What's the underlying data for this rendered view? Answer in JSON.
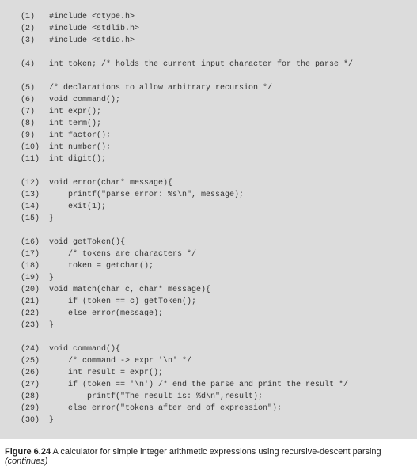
{
  "code": {
    "lines": [
      {
        "no": "(1)",
        "text": "#include <ctype.h>"
      },
      {
        "no": "(2)",
        "text": "#include <stdlib.h>"
      },
      {
        "no": "(3)",
        "text": "#include <stdio.h>"
      },
      {
        "no": "",
        "text": ""
      },
      {
        "no": "(4)",
        "text": "int token; /* holds the current input character for the parse */"
      },
      {
        "no": "",
        "text": ""
      },
      {
        "no": "(5)",
        "text": "/* declarations to allow arbitrary recursion */"
      },
      {
        "no": "(6)",
        "text": "void command();"
      },
      {
        "no": "(7)",
        "text": "int expr();"
      },
      {
        "no": "(8)",
        "text": "int term();"
      },
      {
        "no": "(9)",
        "text": "int factor();"
      },
      {
        "no": "(10)",
        "text": "int number();"
      },
      {
        "no": "(11)",
        "text": "int digit();"
      },
      {
        "no": "",
        "text": ""
      },
      {
        "no": "(12)",
        "text": "void error(char* message){"
      },
      {
        "no": "(13)",
        "text": "    printf(\"parse error: %s\\n\", message);"
      },
      {
        "no": "(14)",
        "text": "    exit(1);"
      },
      {
        "no": "(15)",
        "text": "}"
      },
      {
        "no": "",
        "text": ""
      },
      {
        "no": "(16)",
        "text": "void getToken(){"
      },
      {
        "no": "(17)",
        "text": "    /* tokens are characters */"
      },
      {
        "no": "(18)",
        "text": "    token = getchar();"
      },
      {
        "no": "(19)",
        "text": "}"
      },
      {
        "no": "(20)",
        "text": "void match(char c, char* message){"
      },
      {
        "no": "(21)",
        "text": "    if (token == c) getToken();"
      },
      {
        "no": "(22)",
        "text": "    else error(message);"
      },
      {
        "no": "(23)",
        "text": "}"
      },
      {
        "no": "",
        "text": ""
      },
      {
        "no": "(24)",
        "text": "void command(){"
      },
      {
        "no": "(25)",
        "text": "    /* command -> expr '\\n' */"
      },
      {
        "no": "(26)",
        "text": "    int result = expr();"
      },
      {
        "no": "(27)",
        "text": "    if (token == '\\n') /* end the parse and print the result */"
      },
      {
        "no": "(28)",
        "text": "        printf(\"The result is: %d\\n\",result);"
      },
      {
        "no": "(29)",
        "text": "    else error(\"tokens after end of expression\");"
      },
      {
        "no": "(30)",
        "text": "}"
      }
    ]
  },
  "caption": {
    "label": "Figure 6.24",
    "text": "A calculator for simple integer arithmetic expressions using recursive-descent parsing",
    "continues": "(continues)"
  }
}
